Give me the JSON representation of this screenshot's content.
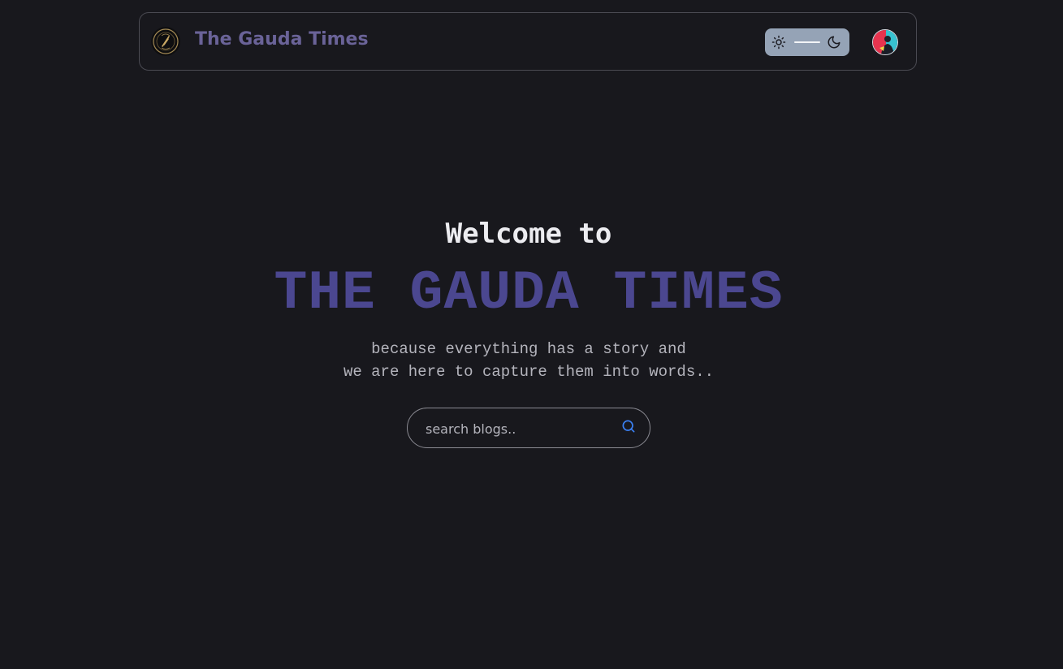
{
  "navbar": {
    "brand": "The Gauda Times",
    "logo_icon": "newspaper-seal-logo",
    "theme_toggle": {
      "light_icon": "sun-icon",
      "dark_icon": "moon-icon",
      "background": "#95a3b6"
    },
    "avatar_icon": "user-avatar"
  },
  "hero": {
    "welcome": "Welcome to",
    "title": "THE GAUDA TIMES",
    "tagline_line1": "because everything has a story and",
    "tagline_line2": "we are here to capture them into words.."
  },
  "search": {
    "placeholder": "search blogs..",
    "value": "",
    "icon": "search-icon"
  },
  "colors": {
    "background": "#18181d",
    "brand": "#6a6398",
    "title": "#4b4790",
    "accent": "#3b82f6"
  }
}
